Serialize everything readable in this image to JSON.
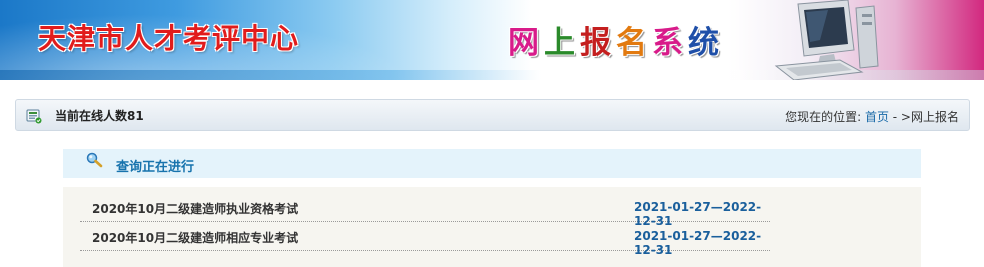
{
  "banner": {
    "site_title": "天津市人才考评中心",
    "system_title_chars": [
      {
        "char": "网",
        "color": "#d81b8a"
      },
      {
        "char": "上",
        "color": "#2a8a2a"
      },
      {
        "char": "报",
        "color": "#c41f1f"
      },
      {
        "char": "名",
        "color": "#e27a10"
      },
      {
        "char": "系",
        "color": "#d81b8a"
      },
      {
        "char": "统",
        "color": "#1f4fa8"
      }
    ]
  },
  "location_bar": {
    "online_count": "当前在线人数81",
    "location_prefix": "您现在的位置: ",
    "home_link": "首页",
    "separator": " - >",
    "current_page": "网上报名"
  },
  "query": {
    "title": "查询正在进行"
  },
  "exams": [
    {
      "name": "2020年10月二级建造师执业资格考试",
      "date_range": "2021-01-27—2022-12-31"
    },
    {
      "name": "2020年10月二级建造师相应专业考试",
      "date_range": "2021-01-27—2022-12-31"
    }
  ]
}
